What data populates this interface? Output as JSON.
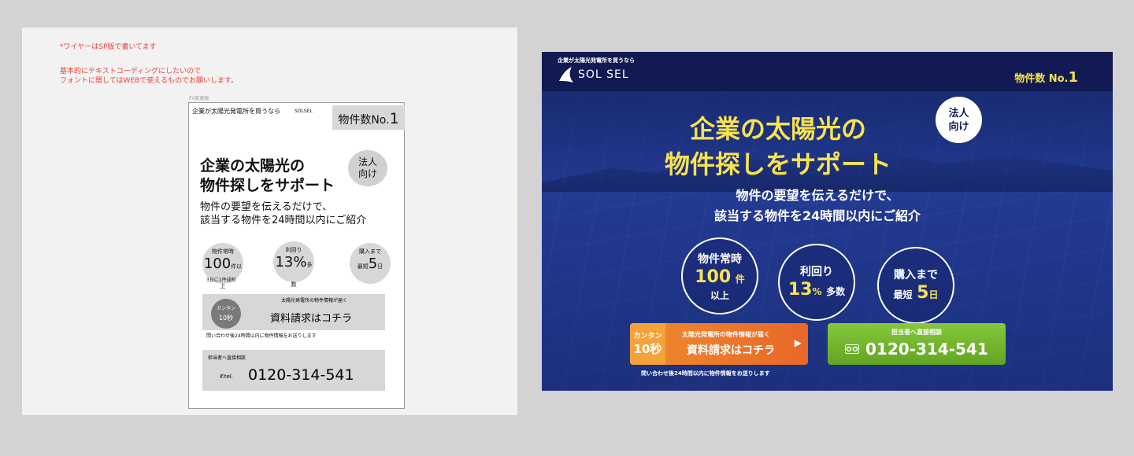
{
  "wireframe": {
    "notes": [
      "*ワイヤーはSP版で書いてます",
      "基本的にテキストコーディングにしたいので",
      "フォントに関してはWEBで使えるものでお願いします。"
    ],
    "tag": "FV変更版",
    "top_text": "企業が太陽光発電所を買うなら",
    "logo": "SOLSEL",
    "badge_prefix": "物件数No.",
    "badge_num": "1",
    "title_line1": "企業の太陽光の",
    "title_line2": "物件探しをサポート",
    "corp_line1": "法人",
    "corp_line2": "向け",
    "sub_line1": "物件の要望を伝えるだけで、",
    "sub_line2": "該当する物件を24時間以内にご紹介",
    "stats": [
      {
        "title": "物件常時",
        "value": "100",
        "unit": "件以上"
      },
      {
        "title": "利回り",
        "value": "13%",
        "unit": "多数"
      },
      {
        "title": "購入まで",
        "pre": "最短",
        "value": "5",
        "unit": "日"
      }
    ],
    "stat1_sub": "3日に1件成約",
    "doc_small": "太陽光発電所の物件情報が届く",
    "doc_main": "資料請求はコチラ",
    "kantan_label": "カンタン",
    "kantan_time": "10秒",
    "doc_note": "問い合わせ後24時間以内に物件情報をお送りします",
    "tel_small": "担当者へ直接相談",
    "tel_label": "tel.",
    "tel_number": "0120-314-541"
  },
  "hero": {
    "tagline": "企業が太陽光発電所を買うなら",
    "logo": "SOL SEL",
    "no1_prefix": "物件数 No.",
    "no1_num": "1",
    "title_line1": "企業の太陽光の",
    "title_line2": "物件探しをサポート",
    "badge_line1": "法人",
    "badge_line2": "向け",
    "sub_line1": "物件の要望を伝えるだけで、",
    "sub_line2": "該当する物件を24時間以内にご紹介",
    "stats": [
      {
        "title": "物件常時",
        "value": "100",
        "unit": "件",
        "suffix": "以上"
      },
      {
        "title": "利回り",
        "value": "13",
        "unit": "%",
        "suffix": "多数"
      },
      {
        "title": "購入まで",
        "pre": "最短",
        "value": "5",
        "unit": "日"
      }
    ],
    "cta_doc": {
      "kantan": "カンタン",
      "time": "10秒",
      "small": "太陽光発電所の物件情報が届く",
      "main": "資料請求はコチラ"
    },
    "cta_note": "問い合わせ後24時間以内に物件情報をお送りします",
    "cta_tel": {
      "small": "担当者へ直接相談",
      "number": "0120-314-541"
    },
    "colors": {
      "navy": "#141f5b",
      "yellow": "#f7e34f",
      "orange": "#e8682a",
      "green": "#61a523"
    }
  }
}
